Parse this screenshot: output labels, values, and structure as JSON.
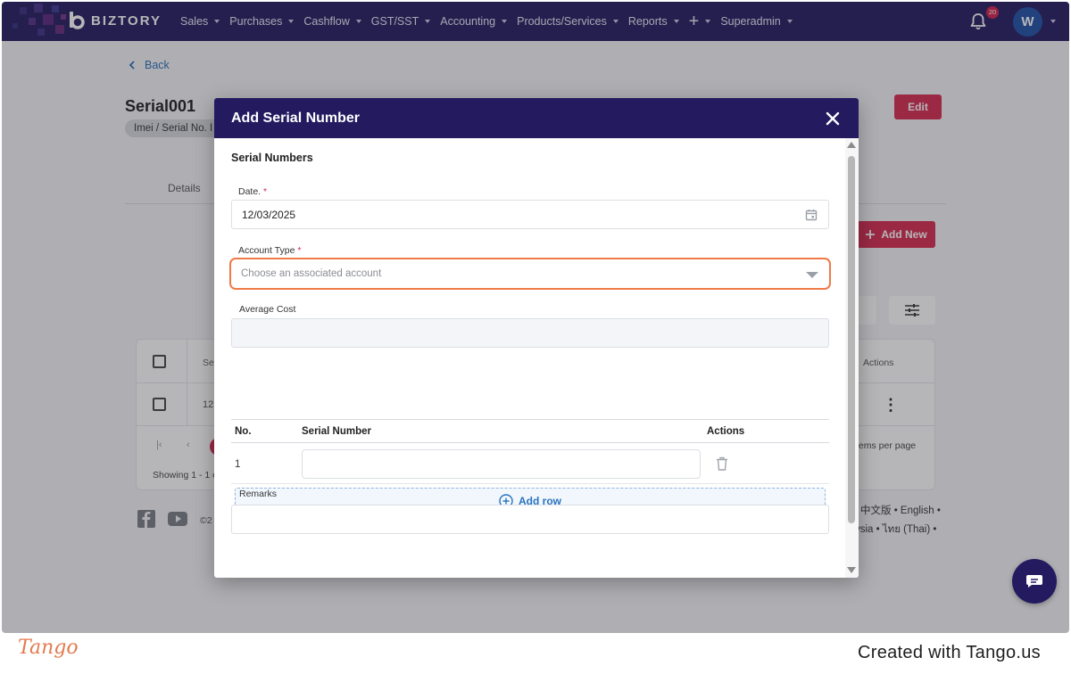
{
  "app": {
    "brand": "BIZTORY",
    "nav": [
      {
        "label": "Sales"
      },
      {
        "label": "Purchases"
      },
      {
        "label": "Cashflow"
      },
      {
        "label": "GST/SST"
      },
      {
        "label": "Accounting"
      },
      {
        "label": "Products/Services"
      },
      {
        "label": "Reports"
      },
      {
        "label": "+"
      },
      {
        "label": "Superadmin"
      }
    ],
    "notification_count": "20",
    "avatar_initial": "W",
    "colors": {
      "nav_bg": "#231a60",
      "accent": "#d6294f",
      "highlight": "#f07a47",
      "link": "#2a6fb8"
    }
  },
  "page": {
    "back_label": "Back",
    "title": "Serial001",
    "chip": "Imei / Serial No. I",
    "edit_label": "Edit",
    "tab_details": "Details",
    "add_new_label": "Add New",
    "table": {
      "header_frag": "Se",
      "actions_header": "Actions",
      "row_frag": "12",
      "items_per_page": "tems per page",
      "showing": "Showing 1 - 1 o"
    },
    "footer": {
      "copyright_frag": "©2",
      "lang_line1": "中文版 • English •",
      "lang_line2": "ysia • ไทย (Thai) •"
    }
  },
  "modal": {
    "title": "Add Serial Number",
    "section_title": "Serial Numbers",
    "date": {
      "label": "Date.",
      "required_mark": "*",
      "value": "12/03/2025"
    },
    "account_type": {
      "label": "Account Type",
      "required_mark": "*",
      "placeholder": "Choose an associated account"
    },
    "average_cost": {
      "label": "Average Cost",
      "value": ""
    },
    "serial_table": {
      "headers": {
        "no": "No.",
        "serial": "Serial Number",
        "actions": "Actions"
      },
      "rows": [
        {
          "no": "1",
          "serial": ""
        }
      ]
    },
    "add_row_label": "Add row",
    "remarks": {
      "label": "Remarks",
      "value": ""
    }
  },
  "tango": {
    "logo": "Tango",
    "created_with": "Created with Tango.us"
  }
}
